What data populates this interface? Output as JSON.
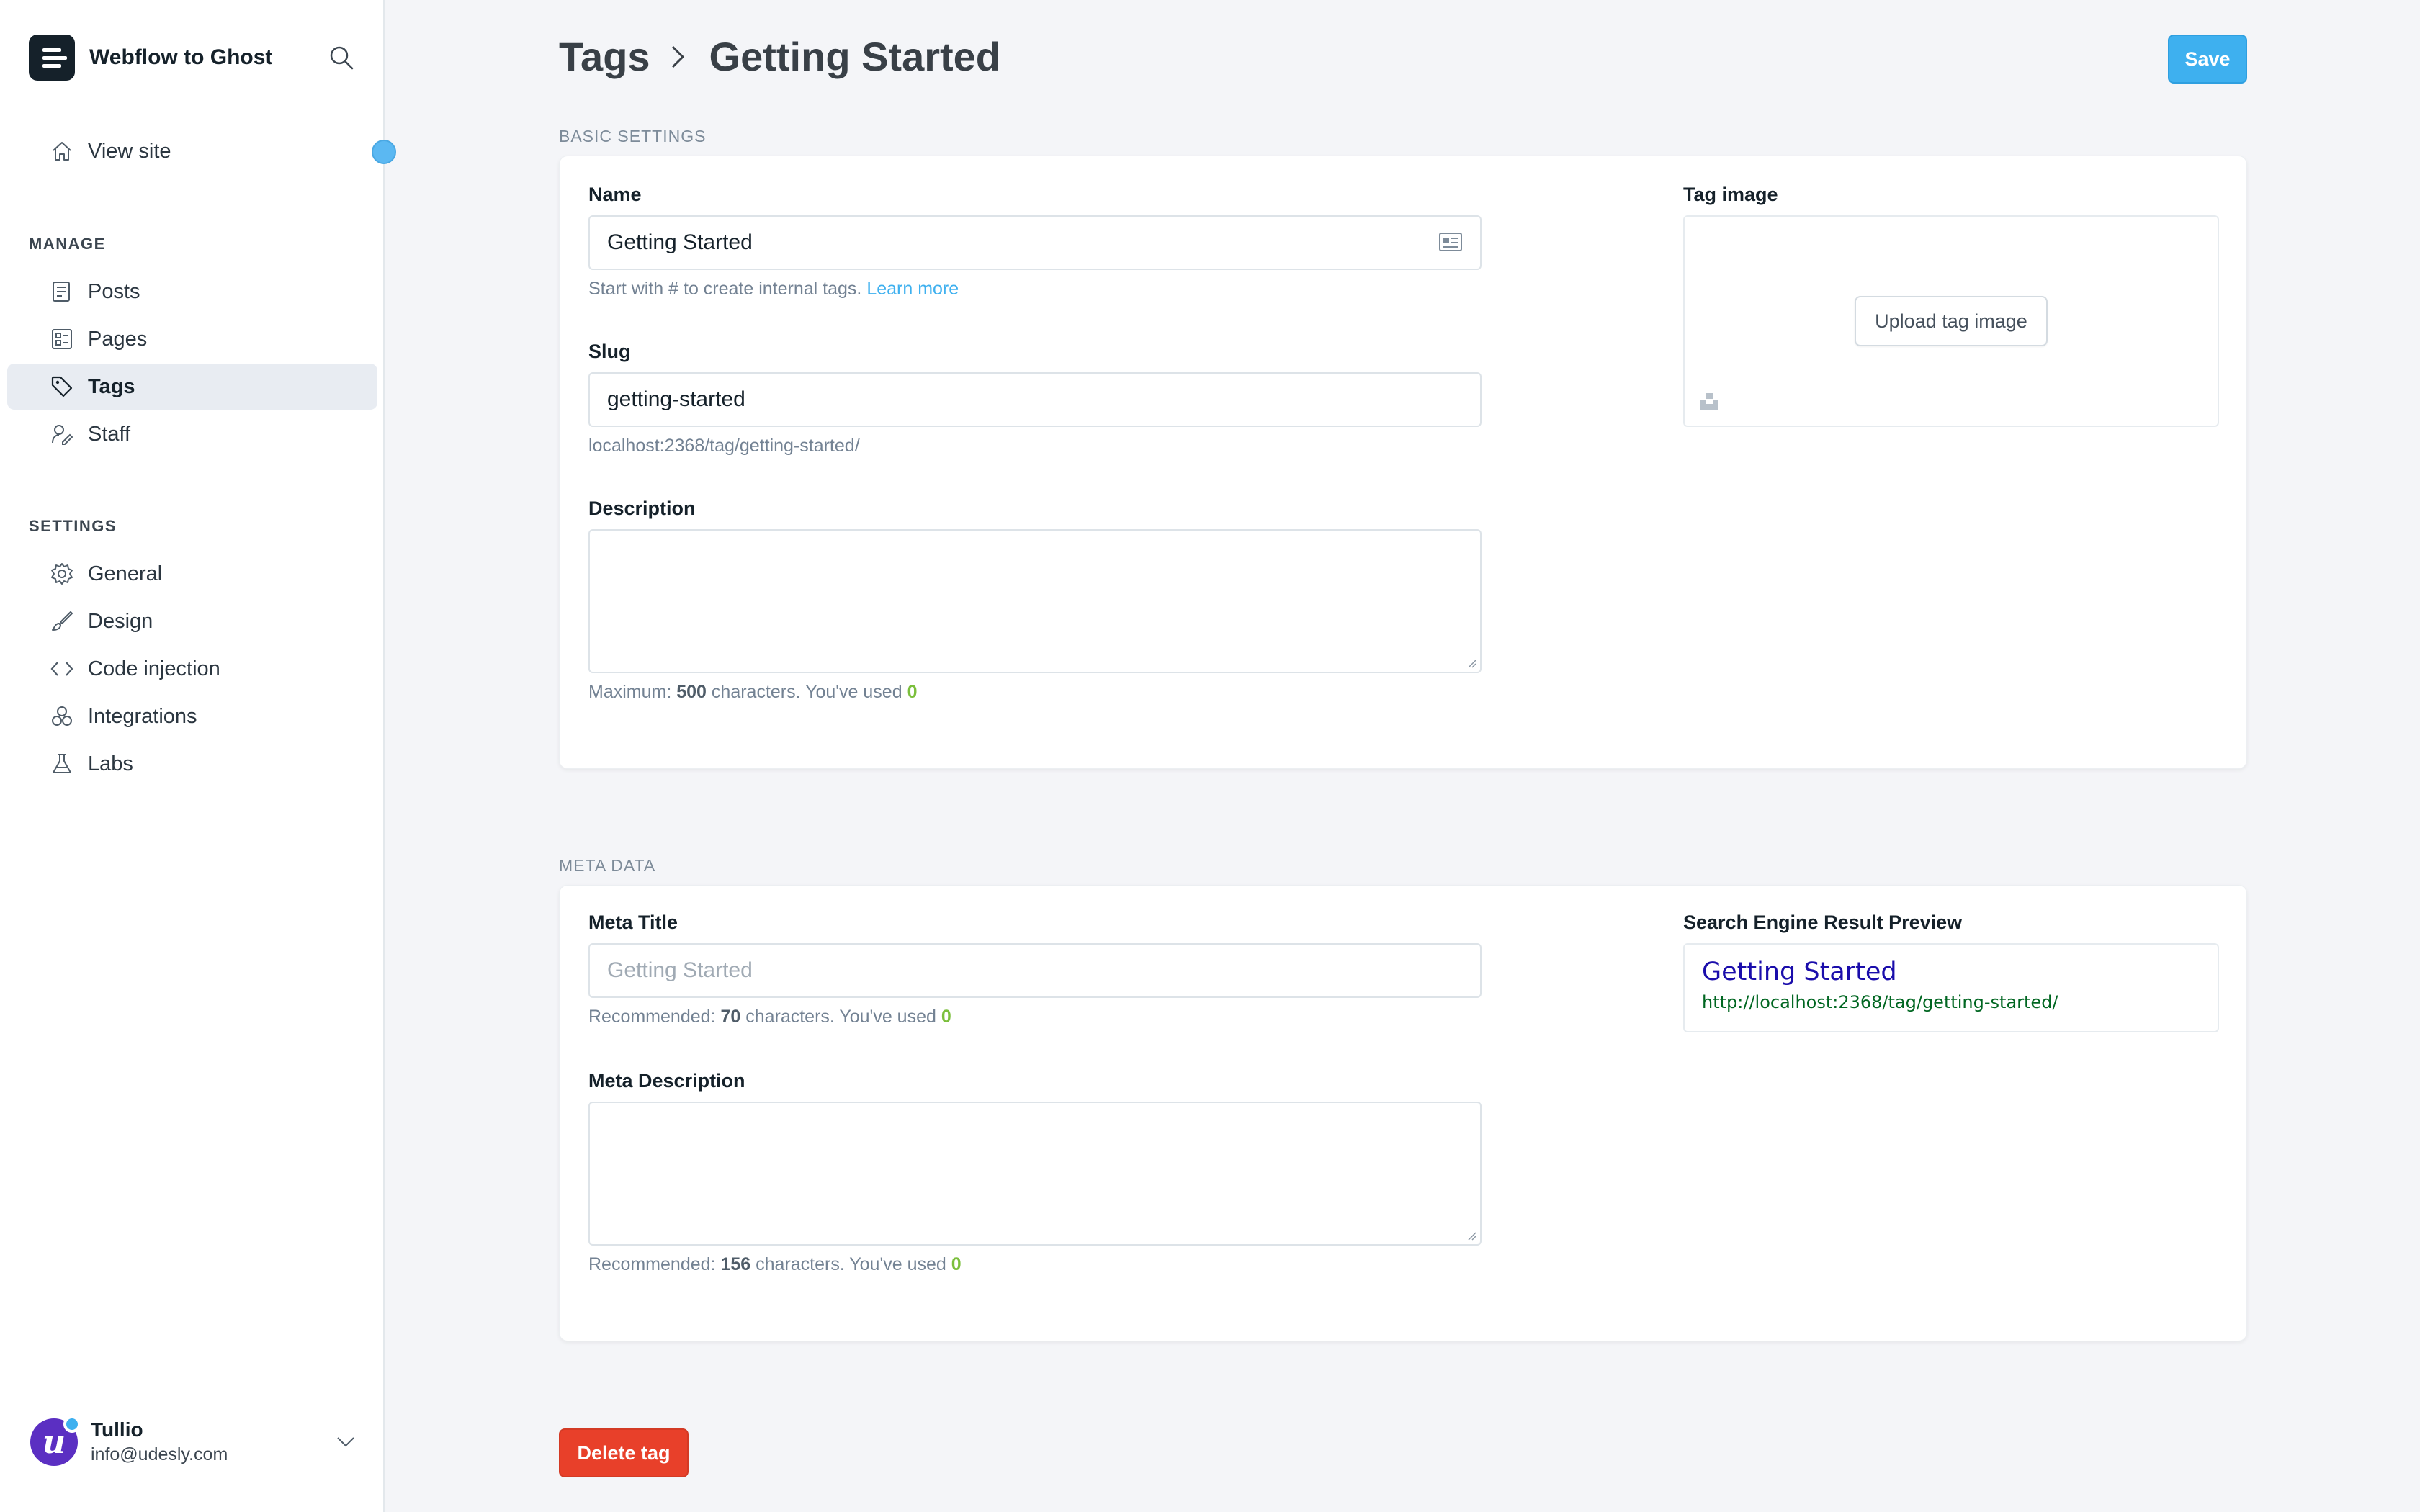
{
  "app": {
    "site_name": "Webflow to Ghost"
  },
  "sidebar": {
    "view_site_label": "View site",
    "manage_label": "MANAGE",
    "manage_items": [
      {
        "label": "Posts",
        "icon": "posts-icon"
      },
      {
        "label": "Pages",
        "icon": "pages-icon"
      },
      {
        "label": "Tags",
        "icon": "tag-icon",
        "active": true
      },
      {
        "label": "Staff",
        "icon": "staff-icon"
      }
    ],
    "settings_label": "SETTINGS",
    "settings_items": [
      {
        "label": "General",
        "icon": "gear-icon"
      },
      {
        "label": "Design",
        "icon": "brush-icon"
      },
      {
        "label": "Code injection",
        "icon": "code-icon"
      },
      {
        "label": "Integrations",
        "icon": "integrations-icon"
      },
      {
        "label": "Labs",
        "icon": "flask-icon"
      }
    ],
    "user": {
      "name": "Tullio",
      "email": "info@udesly.com",
      "avatar_letter": "u"
    }
  },
  "header": {
    "breadcrumb_parent": "Tags",
    "breadcrumb_current": "Getting Started",
    "save_label": "Save"
  },
  "basic": {
    "section_label": "BASIC SETTINGS",
    "name_label": "Name",
    "name_value": "Getting Started",
    "name_hint": "Start with # to create internal tags.",
    "name_hint_link": "Learn more",
    "slug_label": "Slug",
    "slug_value": "getting-started",
    "slug_url": "localhost:2368/tag/getting-started/",
    "description_label": "Description",
    "description_value": "",
    "description_hint_prefix": "Maximum:",
    "description_max": "500",
    "description_hint_mid": "characters. You've used",
    "description_used": "0",
    "tag_image_label": "Tag image",
    "upload_label": "Upload tag image"
  },
  "meta": {
    "section_label": "META DATA",
    "title_label": "Meta Title",
    "title_placeholder": "Getting Started",
    "title_hint_prefix": "Recommended:",
    "title_recommended": "70",
    "title_hint_mid": "characters. You've used",
    "title_used": "0",
    "description_label": "Meta Description",
    "description_hint_prefix": "Recommended:",
    "description_recommended": "156",
    "description_hint_mid": "characters. You've used",
    "description_used": "0",
    "preview_label": "Search Engine Result Preview",
    "preview_title": "Getting Started",
    "preview_url": "http://localhost:2368/tag/getting-started/"
  },
  "footer": {
    "delete_label": "Delete tag"
  },
  "colors": {
    "accent": "#3eb0ef",
    "danger": "#e8402a",
    "count_green": "#7bbf3c",
    "serp_title": "#1a0dab",
    "serp_url": "#006621"
  }
}
